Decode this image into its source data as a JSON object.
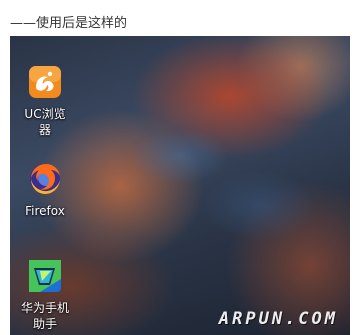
{
  "caption": "——使用后是这样的",
  "desktop": {
    "icons": [
      {
        "label": "UC浏览器",
        "icon": "uc-browser-icon"
      },
      {
        "label": "Firefox",
        "icon": "firefox-icon"
      },
      {
        "label": "华为手机助手",
        "icon": "huawei-hisuite-icon"
      }
    ],
    "watermark": "ARPUN.COM"
  },
  "colors": {
    "uc_orange": "#f28a1e",
    "firefox_orange": "#ff6b1a",
    "firefox_blue": "#3a2e8c",
    "huawei_green": "#46c35a",
    "huawei_blue": "#1d6fd6"
  }
}
